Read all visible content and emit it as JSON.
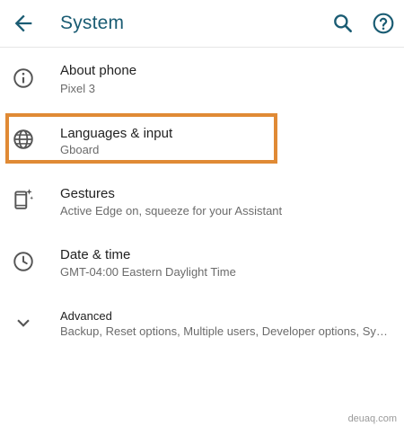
{
  "appbar": {
    "title": "System",
    "back_icon": "arrow-left-icon",
    "search_icon": "search-icon",
    "help_icon": "help-circle-icon"
  },
  "items": [
    {
      "label": "About phone",
      "subtitle": "Pixel 3",
      "icon": "info-icon"
    },
    {
      "label": "Languages & input",
      "subtitle": "Gboard",
      "icon": "globe-icon",
      "highlighted": true
    },
    {
      "label": "Gestures",
      "subtitle": "Active Edge on, squeeze for your Assistant",
      "icon": "gesture-phone-icon"
    },
    {
      "label": "Date & time",
      "subtitle": "GMT-04:00 Eastern Daylight Time",
      "icon": "clock-icon"
    },
    {
      "label": "Advanced",
      "subtitle": "Backup, Reset options, Multiple users, Developer options, System update",
      "icon": "chevron-down-icon"
    }
  ],
  "watermark": "deuaq.com",
  "colors": {
    "title": "#1a5c73",
    "highlight": "#e08a35"
  }
}
